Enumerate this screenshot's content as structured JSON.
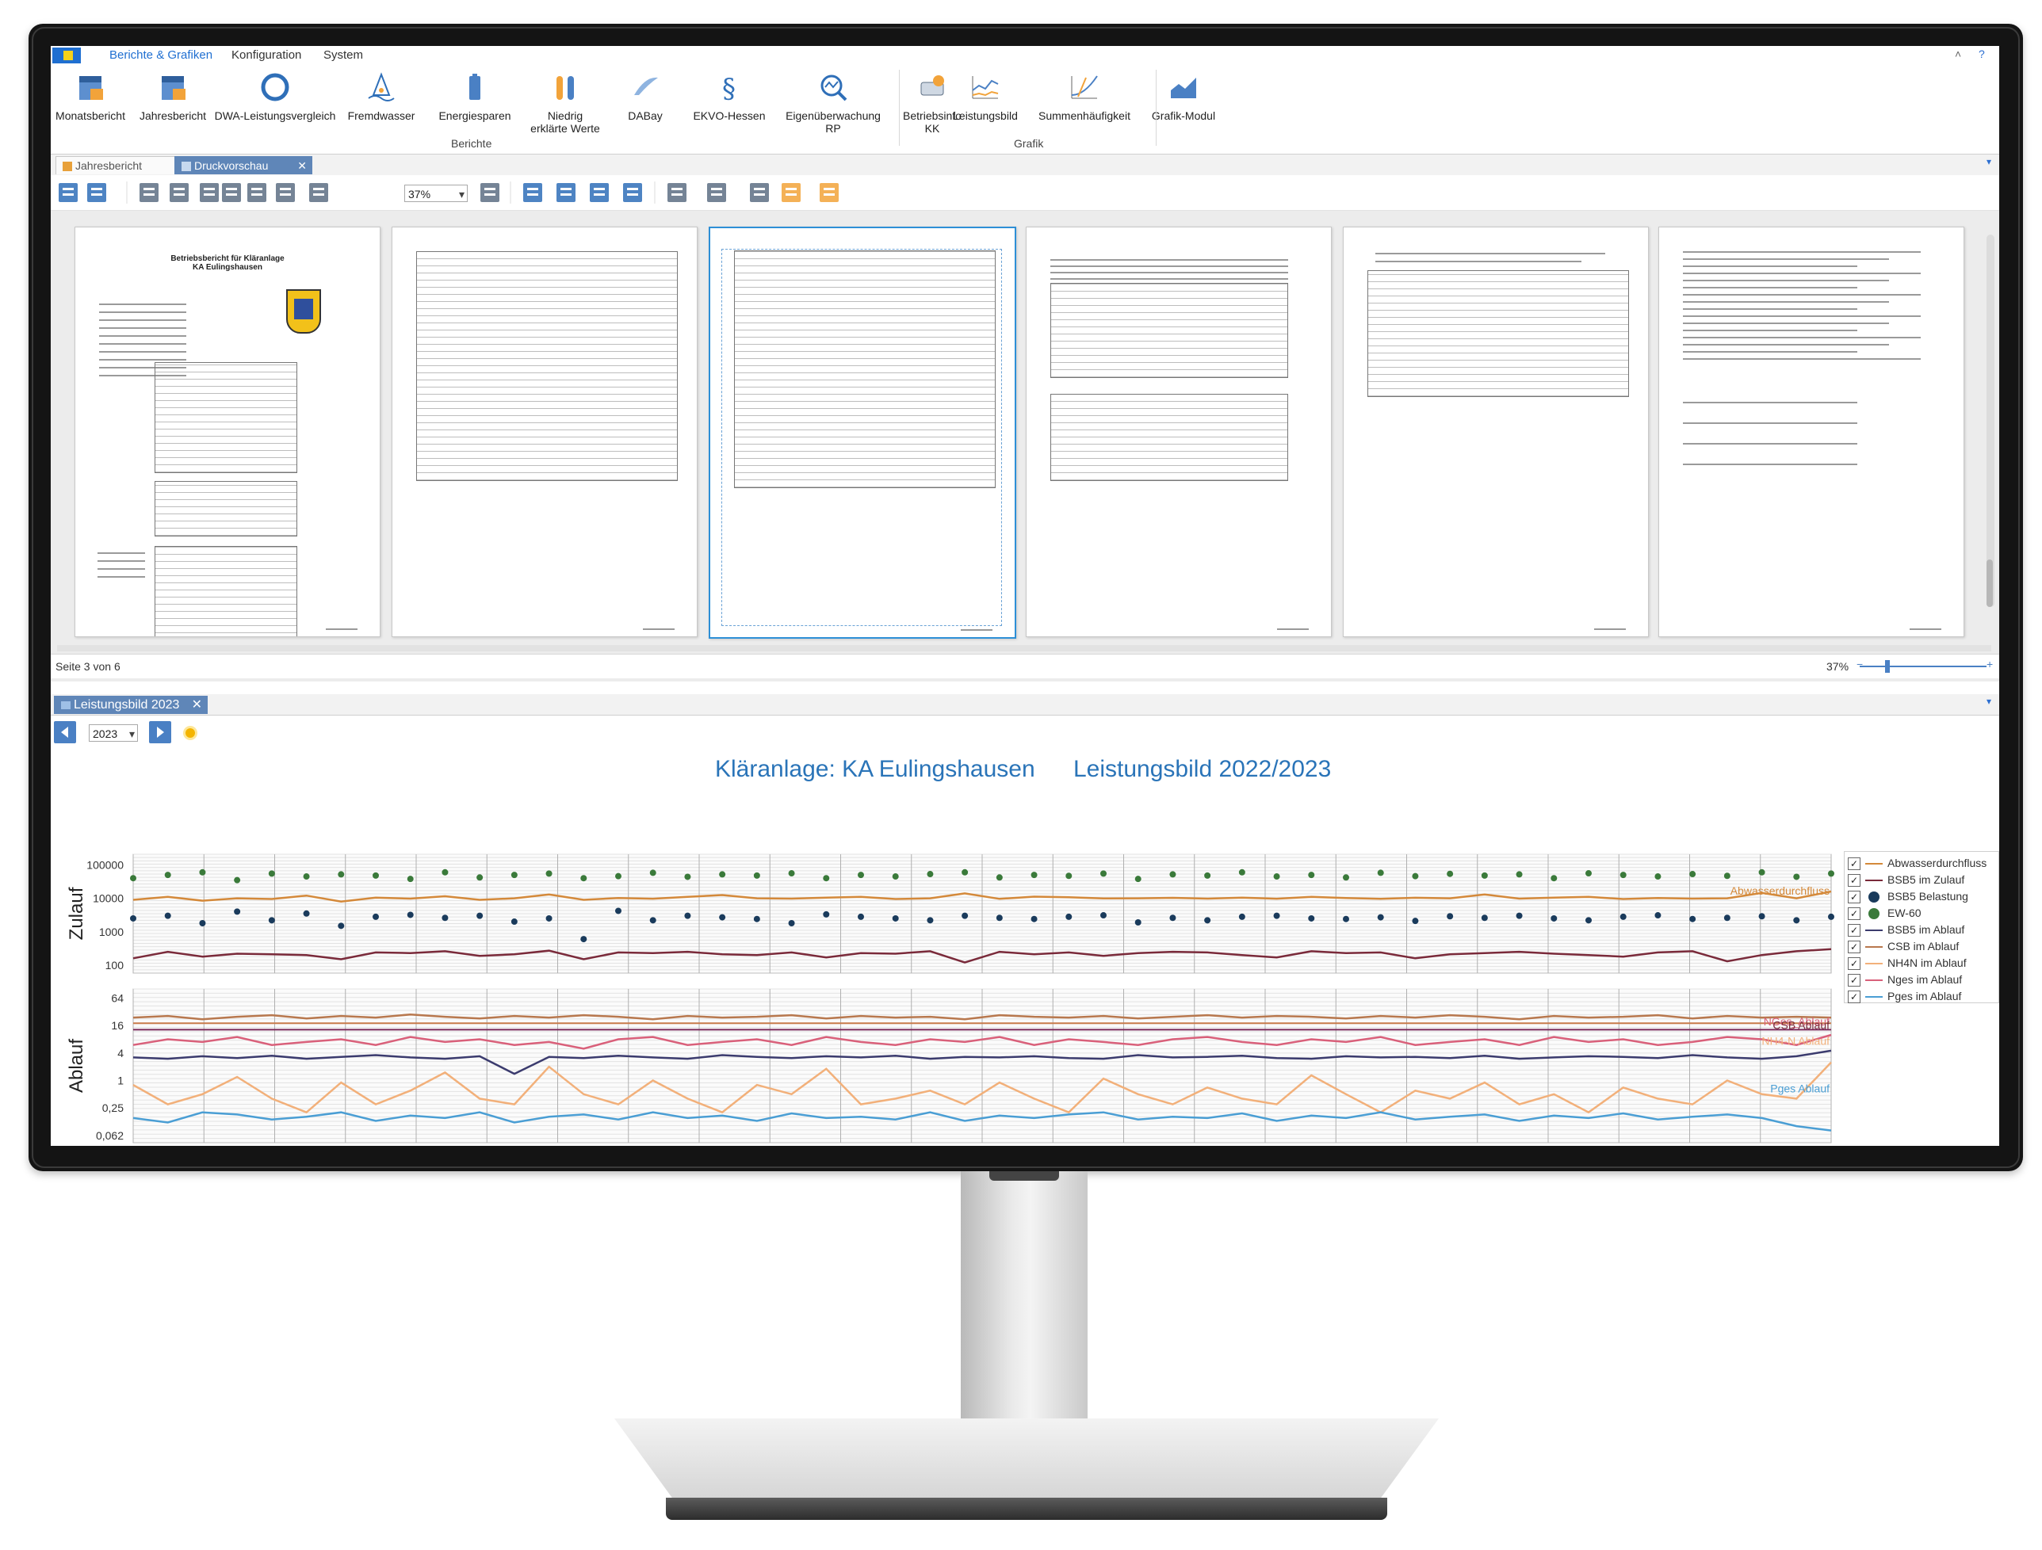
{
  "menu": {
    "tabs": [
      "Berichte & Grafiken",
      "Konfiguration",
      "System"
    ]
  },
  "ribbon": {
    "berichte": [
      {
        "label": "Monatsbericht",
        "icon": "calendar-31-icon"
      },
      {
        "label": "Jahresbericht",
        "icon": "calendar-12-icon"
      },
      {
        "label": "DWA-Leistungsvergleich",
        "icon": "ring-icon"
      },
      {
        "label": "Fremdwasser",
        "icon": "water-drop-icon"
      },
      {
        "label": "Energiesparen",
        "icon": "battery-icon"
      },
      {
        "label": "Niedrig\nerklärte Werte",
        "icon": "test-tubes-icon"
      },
      {
        "label": "DABay",
        "icon": "feather-icon"
      },
      {
        "label": "EKVO-Hessen",
        "icon": "paragraph-icon"
      },
      {
        "label": "Eigenüberwachung\nRP",
        "icon": "magnifier-chart-icon"
      },
      {
        "label": "Betriebsinfo\nKK",
        "icon": "car-info-icon"
      }
    ],
    "grafik": [
      {
        "label": "Leistungsbild",
        "icon": "line-chart-icon"
      },
      {
        "label": "Summenhäufigkeit",
        "icon": "frequency-chart-icon"
      },
      {
        "label": "Grafik-Modul",
        "icon": "area-chart-icon"
      }
    ],
    "group_labels": {
      "berichte": "Berichte",
      "grafik": "Grafik"
    }
  },
  "doc_tabs": [
    "Jahresbericht",
    "Druckvorschau"
  ],
  "toolbar": {
    "zoom": "37%"
  },
  "preview": {
    "page1_title": "Betriebsbericht für Kläranlage\nKA Eulingshausen",
    "status": "Seite 3 von 6",
    "zoom": "37%"
  },
  "chart_panel": {
    "tab": "Leistungsbild 2023",
    "year": "2023"
  },
  "chart_data": {
    "type": "line",
    "title_left": "Kläranlage: KA Eulingshausen",
    "title_right": "Leistungsbild 2022/2023",
    "panels": [
      {
        "ylabel": "Zulauf",
        "scale": "log",
        "ticks": [
          "100000",
          "10000",
          "1000",
          "100"
        ],
        "annotations": [
          "Abwasserdurchfluss"
        ]
      },
      {
        "ylabel": "Ablauf",
        "scale": "log",
        "ticks": [
          "64",
          "16",
          "4",
          "1",
          "0,25",
          "0,062"
        ],
        "annotations": [
          "NGes_Ablauf",
          "CSB Ablauf",
          "NH4-N Ablauf",
          "Pges Ablauf"
        ]
      }
    ],
    "series": [
      {
        "name": "Abwasserdurchfluss",
        "color": "#d4893a",
        "style": "line",
        "values": [
          9000,
          11000,
          8500,
          10000,
          9500,
          12000,
          8000,
          10500,
          9800,
          11500,
          9000,
          10000,
          13000,
          9000,
          10200,
          9700,
          11000,
          12500,
          10000,
          9800,
          10500,
          11000,
          9500,
          10000,
          14000,
          9600,
          11200,
          10800,
          9900,
          10000,
          10300,
          9800,
          10500,
          9700,
          11000,
          10200,
          9600,
          10400,
          10000,
          13000,
          9800,
          10500,
          11000,
          9500,
          10200,
          9800,
          10000,
          14500,
          10000,
          16000
        ]
      },
      {
        "name": "BSB5 im Zulauf",
        "color": "#7a2a3a",
        "style": "line",
        "values": [
          160,
          250,
          180,
          220,
          210,
          200,
          150,
          240,
          230,
          260,
          190,
          210,
          270,
          150,
          240,
          230,
          250,
          210,
          200,
          240,
          170,
          230,
          220,
          260,
          120,
          250,
          210,
          240,
          190,
          230,
          250,
          240,
          200,
          170,
          260,
          230,
          240,
          160,
          210,
          230,
          250,
          220,
          200,
          180,
          240,
          260,
          130,
          200,
          260,
          300
        ]
      },
      {
        "name": "BSB5 Belastung",
        "color": "#1a3b5c",
        "style": "points",
        "values": [
          2500,
          3000,
          1800,
          4000,
          2200,
          3500,
          1500,
          2800,
          3200,
          2600,
          3000,
          2000,
          2500,
          600,
          4200,
          2200,
          3000,
          2700,
          2400,
          1800,
          3300,
          2800,
          2500,
          2200,
          3000,
          2600,
          2400,
          2800,
          3100,
          1900,
          2600,
          2200,
          2800,
          3000,
          2500,
          2400,
          2700,
          2100,
          2900,
          2600,
          3000,
          2500,
          2200,
          2800,
          3100,
          2400,
          2600,
          2900,
          2200,
          2800
        ]
      },
      {
        "name": "EW-60",
        "color": "#3a7a3a",
        "style": "points",
        "values": [
          40000,
          50000,
          60000,
          35000,
          55000,
          45000,
          52000,
          48000,
          38000,
          60000,
          42000,
          50000,
          55000,
          40000,
          46000,
          58000,
          44000,
          52000,
          48000,
          56000,
          40000,
          50000,
          45000,
          53000,
          60000,
          42000,
          50000,
          47000,
          55000,
          38000,
          52000,
          48000,
          60000,
          45000,
          50000,
          42000,
          58000,
          46000,
          54000,
          48000,
          52000,
          40000,
          56000,
          50000,
          45000,
          53000,
          47000,
          60000,
          44000,
          55000
        ]
      },
      {
        "name": "BSB5 im Ablauf",
        "color": "#3b3b6e",
        "style": "line",
        "values": [
          3.2,
          3.0,
          3.4,
          3.1,
          3.5,
          3.0,
          3.3,
          3.6,
          3.2,
          3.0,
          3.4,
          1.4,
          3.3,
          3.1,
          3.5,
          3.2,
          3.0,
          3.6,
          3.3,
          3.1,
          3.4,
          3.2,
          3.5,
          3.0,
          3.3,
          3.2,
          3.4,
          3.1,
          3.0,
          3.6,
          3.2,
          3.3,
          3.5,
          3.1,
          3.0,
          3.4,
          3.2,
          3.3,
          3.1,
          3.5,
          3.0,
          3.2,
          3.4,
          3.3,
          3.1,
          3.6,
          3.2,
          3.0,
          3.4,
          4.5
        ]
      },
      {
        "name": "CSB im Ablauf",
        "color": "#b8784e",
        "style": "line",
        "values": [
          24,
          26,
          22,
          25,
          27,
          23,
          26,
          24,
          28,
          25,
          23,
          26,
          24,
          27,
          25,
          22,
          26,
          24,
          25,
          27,
          23,
          26,
          24,
          25,
          22,
          27,
          25,
          24,
          26,
          23,
          25,
          27,
          24,
          26,
          25,
          23,
          26,
          24,
          27,
          25,
          22,
          26,
          24,
          25,
          27,
          23,
          26,
          24,
          25,
          24
        ]
      },
      {
        "name": "NH4N im Ablauf",
        "color": "#f2b07a",
        "style": "line",
        "values": [
          0.8,
          0.3,
          0.5,
          1.2,
          0.4,
          0.2,
          0.9,
          0.3,
          0.6,
          1.5,
          0.4,
          0.3,
          2.0,
          0.5,
          0.3,
          1.0,
          0.4,
          0.2,
          0.8,
          0.5,
          1.8,
          0.3,
          0.4,
          0.6,
          0.3,
          0.9,
          0.4,
          0.2,
          1.1,
          0.5,
          0.3,
          0.7,
          0.4,
          0.3,
          1.3,
          0.5,
          0.2,
          0.6,
          0.4,
          0.9,
          0.3,
          0.5,
          0.2,
          0.7,
          0.4,
          0.3,
          1.0,
          0.5,
          0.4,
          2.5
        ]
      },
      {
        "name": "Nges im Ablauf",
        "color": "#d9607a",
        "style": "line",
        "values": [
          6,
          8,
          7,
          9,
          6,
          7,
          8,
          6,
          9,
          7,
          8,
          6,
          7,
          5,
          8,
          9,
          6,
          7,
          8,
          6,
          9,
          7,
          6,
          8,
          7,
          9,
          6,
          8,
          7,
          6,
          8,
          9,
          7,
          6,
          8,
          7,
          9,
          6,
          7,
          8,
          6,
          9,
          7,
          8,
          6,
          7,
          9,
          8,
          6,
          10
        ]
      },
      {
        "name": "Pges im Ablauf",
        "color": "#4a9ed4",
        "style": "line",
        "values": [
          0.15,
          0.12,
          0.2,
          0.18,
          0.14,
          0.16,
          0.2,
          0.13,
          0.17,
          0.15,
          0.2,
          0.12,
          0.16,
          0.18,
          0.14,
          0.2,
          0.15,
          0.17,
          0.13,
          0.19,
          0.15,
          0.16,
          0.14,
          0.2,
          0.13,
          0.17,
          0.15,
          0.18,
          0.2,
          0.14,
          0.16,
          0.15,
          0.19,
          0.13,
          0.17,
          0.15,
          0.2,
          0.14,
          0.16,
          0.18,
          0.13,
          0.17,
          0.15,
          0.19,
          0.14,
          0.16,
          0.18,
          0.15,
          0.1,
          0.08
        ]
      }
    ],
    "legend_position": "right"
  }
}
